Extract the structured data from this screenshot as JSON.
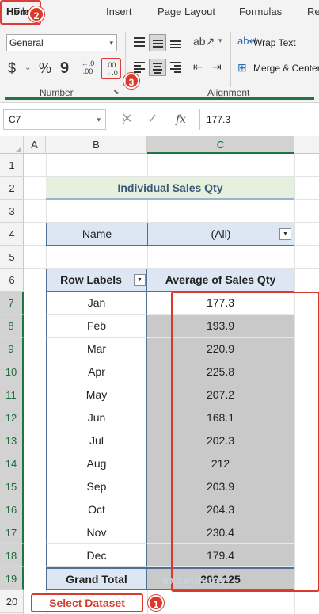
{
  "ribbon": {
    "tabs": [
      "File",
      "Home",
      "Insert",
      "Page Layout",
      "Formulas",
      "Re"
    ],
    "number_format": "General",
    "number_group_label": "Number",
    "alignment_group_label": "Alignment",
    "wrap_text_label": "Wrap Text",
    "merge_center_label": "Merge & Center",
    "currency_symbol": "$",
    "percent_symbol": "%",
    "comma_symbol": "9",
    "decrease_decimal_text": "←0\n.00",
    "increase_decimal_text": ".00\n→.0"
  },
  "steps": {
    "home_step": "2",
    "increase_decimal_step": "3",
    "select_step": "1"
  },
  "formula_bar": {
    "cell_ref": "C7",
    "cancel": "✕",
    "confirm": "✓",
    "fx": "fx",
    "formula": "177.3"
  },
  "grid": {
    "columns": [
      "A",
      "B",
      "C"
    ],
    "rows": [
      "1",
      "2",
      "3",
      "4",
      "5",
      "6",
      "7",
      "8",
      "9",
      "10",
      "11",
      "12",
      "13",
      "14",
      "15",
      "16",
      "17",
      "18",
      "19",
      "20"
    ]
  },
  "sheet": {
    "title": "Individual Sales Qty",
    "filter_label": "Name",
    "filter_value": "(All)",
    "pivot_header_labels": "Row Labels",
    "pivot_header_values": "Average of Sales Qty",
    "rows": [
      {
        "month": "Jan",
        "value": "177.3"
      },
      {
        "month": "Feb",
        "value": "193.9"
      },
      {
        "month": "Mar",
        "value": "220.9"
      },
      {
        "month": "Apr",
        "value": "225.8"
      },
      {
        "month": "May",
        "value": "207.2"
      },
      {
        "month": "Jun",
        "value": "168.1"
      },
      {
        "month": "Jul",
        "value": "202.3"
      },
      {
        "month": "Aug",
        "value": "212"
      },
      {
        "month": "Sep",
        "value": "203.9"
      },
      {
        "month": "Oct",
        "value": "204.3"
      },
      {
        "month": "Nov",
        "value": "230.4"
      },
      {
        "month": "Dec",
        "value": "179.4"
      }
    ],
    "grand_total_label": "Grand Total",
    "grand_total_value": "202.125"
  },
  "annotation": {
    "select_label": "Select Dataset"
  },
  "watermark": {
    "brand": "exceldemy",
    "tagline": "EXCEL · DATA · BI"
  },
  "colors": {
    "accent_red": "#d93a2b",
    "excel_green": "#217346",
    "pivot_header_bg": "#dde6f3",
    "title_bg": "#e6f0df"
  }
}
